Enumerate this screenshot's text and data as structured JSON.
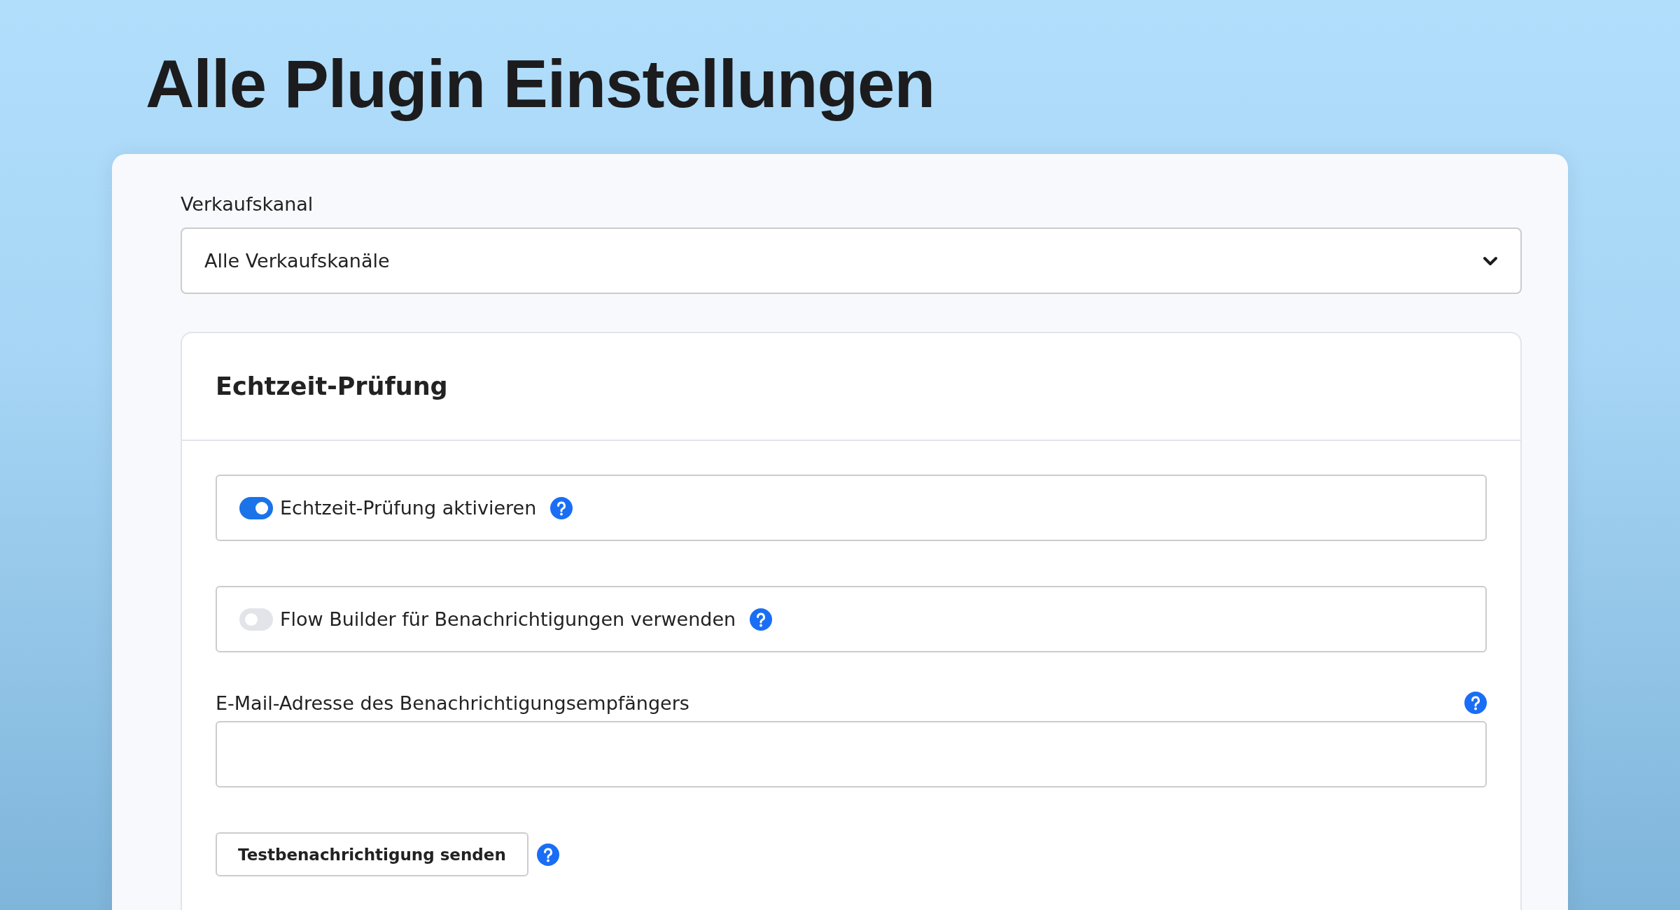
{
  "title": "Alle Plugin Einstellungen",
  "sales_channel": {
    "label": "Verkaufskanal",
    "value": "Alle Verkaufskanäle"
  },
  "section": {
    "title": "Echtzeit-Prüfung",
    "toggles": [
      {
        "label": "Echtzeit-Prüfung aktivieren",
        "on": true
      },
      {
        "label": "Flow Builder für Benachrichtigungen verwenden",
        "on": false
      }
    ],
    "email": {
      "label": "E-Mail-Adresse des Benachrichtigungsempfängers"
    },
    "test_button": "Testbenachrichtigung senden"
  }
}
